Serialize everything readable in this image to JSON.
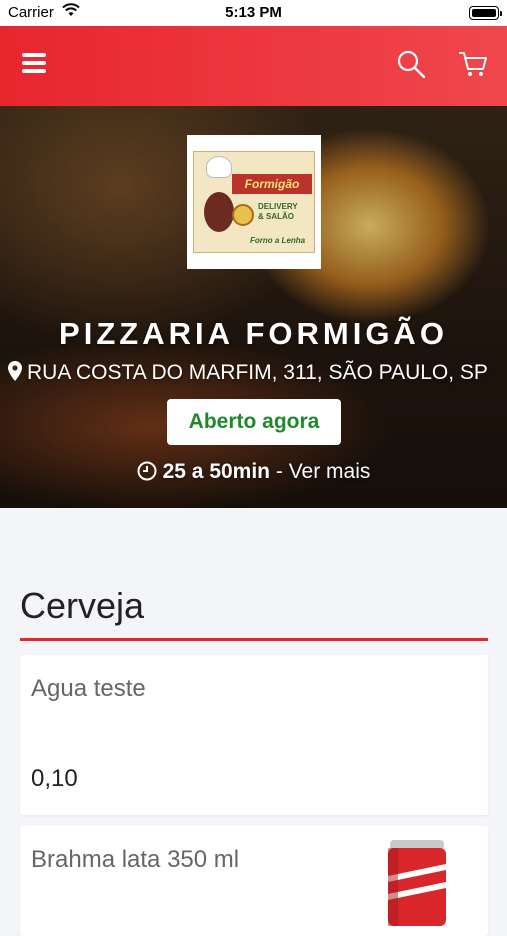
{
  "status_bar": {
    "carrier": "Carrier",
    "time": "5:13 PM"
  },
  "navbar": {
    "accent_color": "#e8262e",
    "icons": [
      "menu-icon",
      "search-icon",
      "cart-icon"
    ]
  },
  "store": {
    "logo": {
      "banner_text": "Formigão",
      "tagline_1": "DELIVERY",
      "tagline_2": "& SALÃO",
      "tagline_3": "Forno a Lenha"
    },
    "name": "PIZZARIA FORMIGÃO",
    "address": "RUA COSTA DO MARFIM, 311, SÃO PAULO, SP",
    "status": "Aberto agora",
    "status_color": "#1e8a2a",
    "delivery_time": "25 a 50min",
    "delivery_separator": " - ",
    "more_link": "Ver mais"
  },
  "menu": {
    "section_title": "Cerveja",
    "products": [
      {
        "name": "Agua teste",
        "price": "0,10"
      },
      {
        "name": "Brahma lata 350 ml",
        "image_icon": "beer-can-icon"
      }
    ]
  }
}
